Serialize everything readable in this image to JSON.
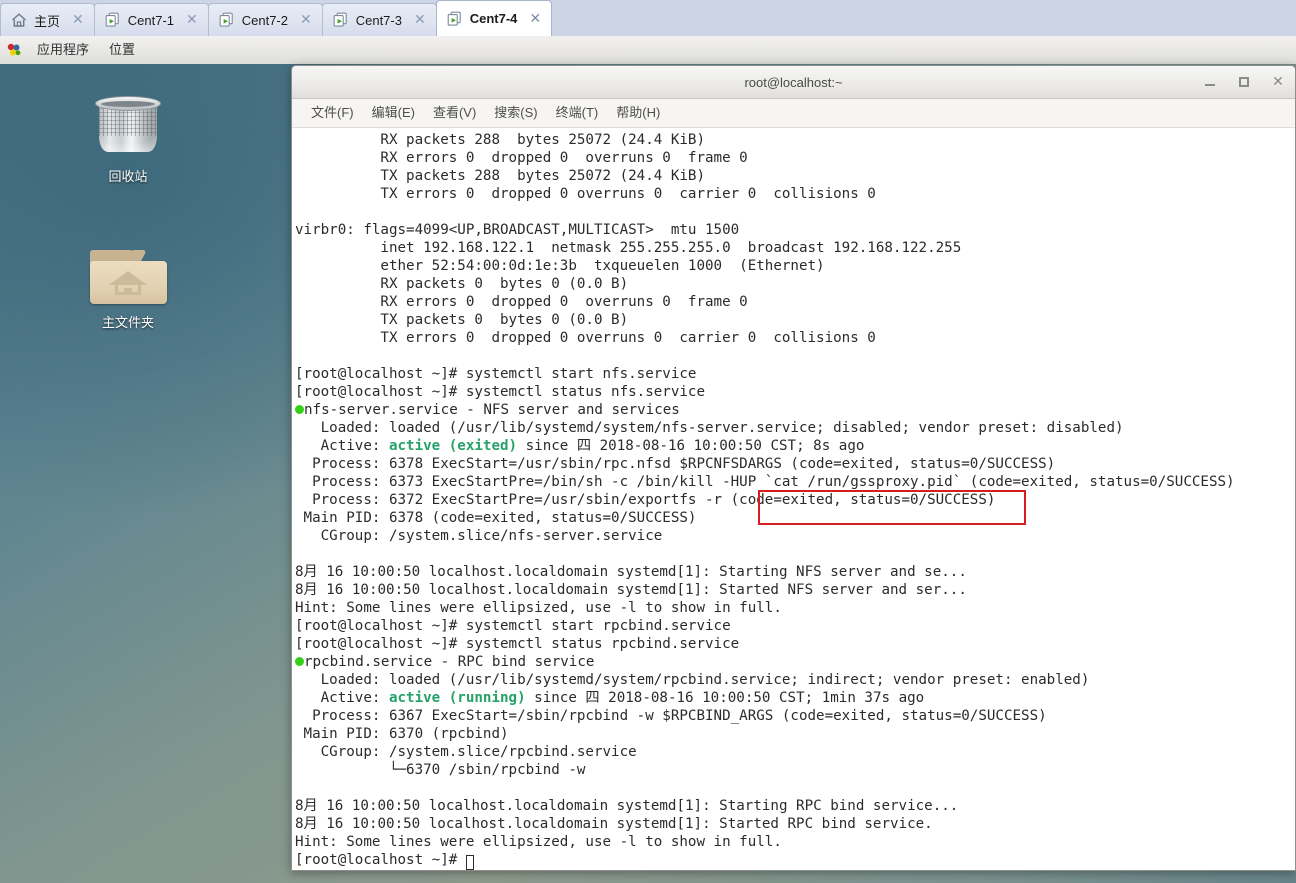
{
  "tabbar": {
    "tabs": [
      {
        "label": "主页",
        "icon": "home-icon",
        "close": "✕",
        "active": false
      },
      {
        "label": "Cent7-1",
        "icon": "vm-icon",
        "close": "✕",
        "active": false
      },
      {
        "label": "Cent7-2",
        "icon": "vm-icon",
        "close": "✕",
        "active": false
      },
      {
        "label": "Cent7-3",
        "icon": "vm-icon",
        "close": "✕",
        "active": false
      },
      {
        "label": "Cent7-4",
        "icon": "vm-icon",
        "close": "✕",
        "active": true
      }
    ]
  },
  "gnome_panel": {
    "applications": "应用程序",
    "places": "位置"
  },
  "desktop": {
    "icons": [
      {
        "name": "trash",
        "caption": "回收站"
      },
      {
        "name": "home-folder",
        "caption": "主文件夹"
      }
    ]
  },
  "terminal": {
    "title": "root@localhost:~",
    "window_buttons": {
      "minimize": "minimize-icon",
      "maximize": "maximize-icon",
      "close": "✕"
    },
    "menu": [
      "文件(F)",
      "编辑(E)",
      "查看(V)",
      "搜索(S)",
      "终端(T)",
      "帮助(H)"
    ],
    "highlight_color": "#d61d20",
    "status_dot_color": "#33d017",
    "active_color": "#26a269",
    "lines": [
      {
        "t": "          RX packets 288  bytes 25072 (24.4 KiB)"
      },
      {
        "t": "          RX errors 0  dropped 0  overruns 0  frame 0"
      },
      {
        "t": "          TX packets 288  bytes 25072 (24.4 KiB)"
      },
      {
        "t": "          TX errors 0  dropped 0 overruns 0  carrier 0  collisions 0"
      },
      {
        "t": ""
      },
      {
        "t": "virbr0: flags=4099<UP,BROADCAST,MULTICAST>  mtu 1500"
      },
      {
        "t": "          inet 192.168.122.1  netmask 255.255.255.0  broadcast 192.168.122.255"
      },
      {
        "t": "          ether 52:54:00:0d:1e:3b  txqueuelen 1000  (Ethernet)"
      },
      {
        "t": "          RX packets 0  bytes 0 (0.0 B)"
      },
      {
        "t": "          RX errors 0  dropped 0  overruns 0  frame 0"
      },
      {
        "t": "          TX packets 0  bytes 0 (0.0 B)"
      },
      {
        "t": "          TX errors 0  dropped 0 overruns 0  carrier 0  collisions 0"
      },
      {
        "t": ""
      },
      {
        "t": "[root@localhost ~]# systemctl start nfs.service"
      },
      {
        "t": "[root@localhost ~]# systemctl status nfs.service"
      },
      {
        "dot": true,
        "t": "nfs-server.service - NFS server and services"
      },
      {
        "t": "   Loaded: loaded (/usr/lib/systemd/system/nfs-server.service; disabled; vendor preset: disabled)"
      },
      {
        "pre": "   Active: ",
        "green": "active (exited)",
        "post": " since 四 2018-08-16 10:00:50 CST; 8s ago"
      },
      {
        "t": "  Process: 6378 ExecStart=/usr/sbin/rpc.nfsd $RPCNFSDARGS (code=exited, status=0/SUCCESS)"
      },
      {
        "t": "  Process: 6373 ExecStartPre=/bin/sh -c /bin/kill -HUP `cat /run/gssproxy.pid` (code=exited, status=0/SUCCESS)"
      },
      {
        "t": "  Process: 6372 ExecStartPre=/usr/sbin/exportfs -r (code=exited, status=0/SUCCESS)"
      },
      {
        "t": " Main PID: 6378 (code=exited, status=0/SUCCESS)"
      },
      {
        "t": "   CGroup: /system.slice/nfs-server.service"
      },
      {
        "t": ""
      },
      {
        "t": "8月 16 10:00:50 localhost.localdomain systemd[1]: Starting NFS server and se..."
      },
      {
        "t": "8月 16 10:00:50 localhost.localdomain systemd[1]: Started NFS server and ser..."
      },
      {
        "t": "Hint: Some lines were ellipsized, use -l to show in full."
      },
      {
        "t": "[root@localhost ~]# systemctl start rpcbind.service"
      },
      {
        "t": "[root@localhost ~]# systemctl status rpcbind.service"
      },
      {
        "dot": true,
        "t": "rpcbind.service - RPC bind service"
      },
      {
        "t": "   Loaded: loaded (/usr/lib/systemd/system/rpcbind.service; indirect; vendor preset: enabled)"
      },
      {
        "pre": "   Active: ",
        "green": "active (running)",
        "post": " since 四 2018-08-16 10:00:50 CST; 1min 37s ago"
      },
      {
        "t": "  Process: 6367 ExecStart=/sbin/rpcbind -w $RPCBIND_ARGS (code=exited, status=0/SUCCESS)"
      },
      {
        "t": " Main PID: 6370 (rpcbind)"
      },
      {
        "t": "   CGroup: /system.slice/rpcbind.service"
      },
      {
        "t": "           └─6370 /sbin/rpcbind -w"
      },
      {
        "t": ""
      },
      {
        "t": "8月 16 10:00:50 localhost.localdomain systemd[1]: Starting RPC bind service..."
      },
      {
        "t": "8月 16 10:00:50 localhost.localdomain systemd[1]: Started RPC bind service."
      },
      {
        "t": "Hint: Some lines were ellipsized, use -l to show in full."
      },
      {
        "t": "[root@localhost ~]# ",
        "cursor": true
      }
    ]
  }
}
